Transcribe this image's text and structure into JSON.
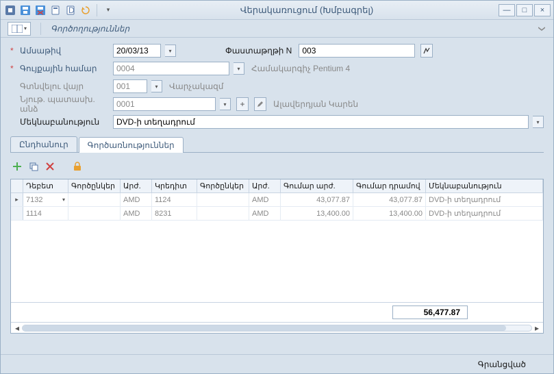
{
  "window": {
    "title": "Վերակառուցում (Խմբագրել)"
  },
  "toolbar": {
    "operations": "Գործողություններ"
  },
  "form": {
    "date_label": "Ամսաթիվ",
    "date_value": "20/03/13",
    "docnum_label": "Փաստաթղթի N",
    "docnum_value": "003",
    "inv_label": "Գույքային համար",
    "inv_value": "0004",
    "inv_side": "Համակարգիչ Pentium 4",
    "loc_label": "Գտնվելու վայր",
    "loc_value": "001",
    "loc_side": "Վարչակազմ",
    "resp_label": "Նյութ. պատասխ. անձ",
    "resp_value": "0001",
    "resp_side": "Ալավերդյան Կարեն",
    "comment_label": "Մեկնաբանություն",
    "comment_value": "DVD-ի տեղադրում"
  },
  "tabs": {
    "t1": "Ընդհանուր",
    "t2": "Գործառնություններ"
  },
  "grid": {
    "headers": {
      "debit": "Դեբետ",
      "partners1": "Գործընկեր",
      "cur1": "Արժ.",
      "credit": "Կրեդիտ",
      "partners2": "Գործընկեր",
      "cur2": "Արժ.",
      "amt_cur": "Գումար արժ.",
      "amt_dram": "Գումար դրամով",
      "comment": "Մեկնաբանություն"
    },
    "rows": [
      {
        "debit": "7132",
        "p1": "",
        "cur1": "AMD",
        "credit": "1124",
        "p2": "",
        "cur2": "AMD",
        "amtc": "43,077.87",
        "amtd": "43,077.87",
        "comment": "DVD-ի տեղադրում",
        "active": true
      },
      {
        "debit": "1114",
        "p1": "",
        "cur1": "AMD",
        "credit": "8231",
        "p2": "",
        "cur2": "AMD",
        "amtc": "13,400.00",
        "amtd": "13,400.00",
        "comment": "DVD-ի տեղադրում",
        "active": false
      }
    ],
    "total": "56,477.87"
  },
  "status": {
    "text": "Գրանցված"
  }
}
